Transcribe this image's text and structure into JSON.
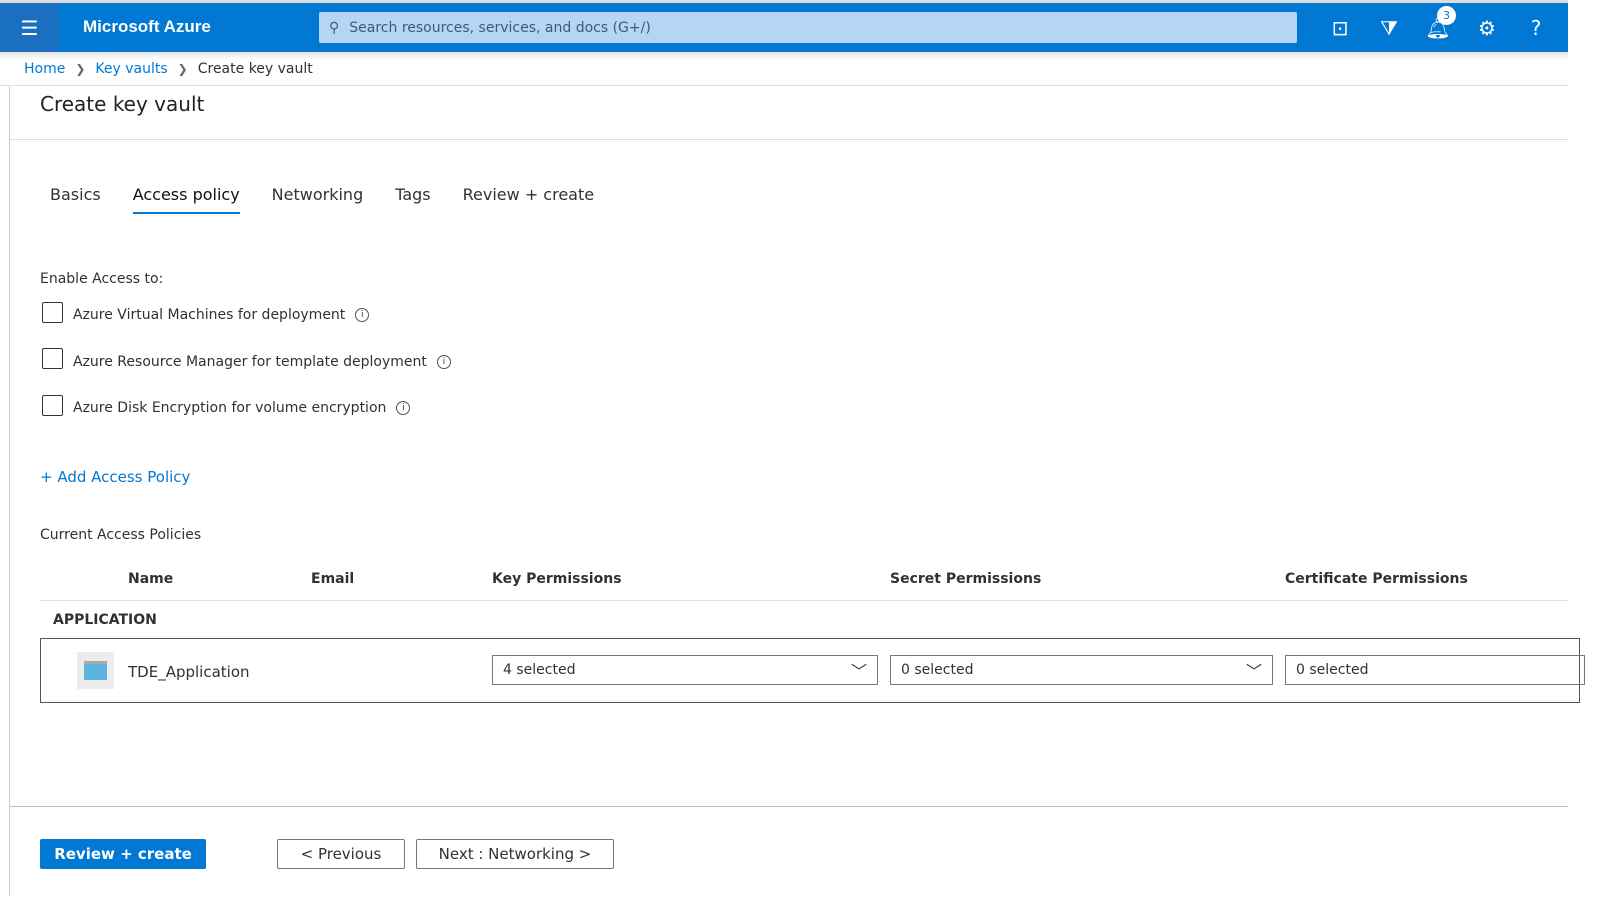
{
  "header": {
    "brand": "Microsoft Azure",
    "search_placeholder": "Search resources, services, and docs (G+/)",
    "notifications_count": "3",
    "accent": "#0078d4"
  },
  "breadcrumb": [
    "Home",
    "Key vaults",
    "Create key vault"
  ],
  "page_title": "Create key vault",
  "tabs": [
    "Basics",
    "Access policy",
    "Networking",
    "Tags",
    "Review + create"
  ],
  "active_tab": "Access policy",
  "enable_access": {
    "label": "Enable Access to:",
    "options": [
      {
        "label": "Azure Virtual Machines for deployment",
        "checked": false
      },
      {
        "label": "Azure Resource Manager for template deployment",
        "checked": false
      },
      {
        "label": "Azure Disk Encryption for volume encryption",
        "checked": false
      }
    ]
  },
  "add_policy": "+ Add Access Policy",
  "current_label": "Current Access Policies",
  "table": {
    "headers": [
      "Name",
      "Email",
      "Key Permissions",
      "Secret Permissions",
      "Certificate Permissions"
    ],
    "group": "APPLICATION",
    "row": {
      "name": "TDE_Application",
      "key": "4 selected",
      "secret": "0 selected",
      "certificate": "0 selected"
    }
  },
  "footer": {
    "review": "Review + create",
    "previous": "< Previous",
    "next": "Next : Networking >"
  }
}
